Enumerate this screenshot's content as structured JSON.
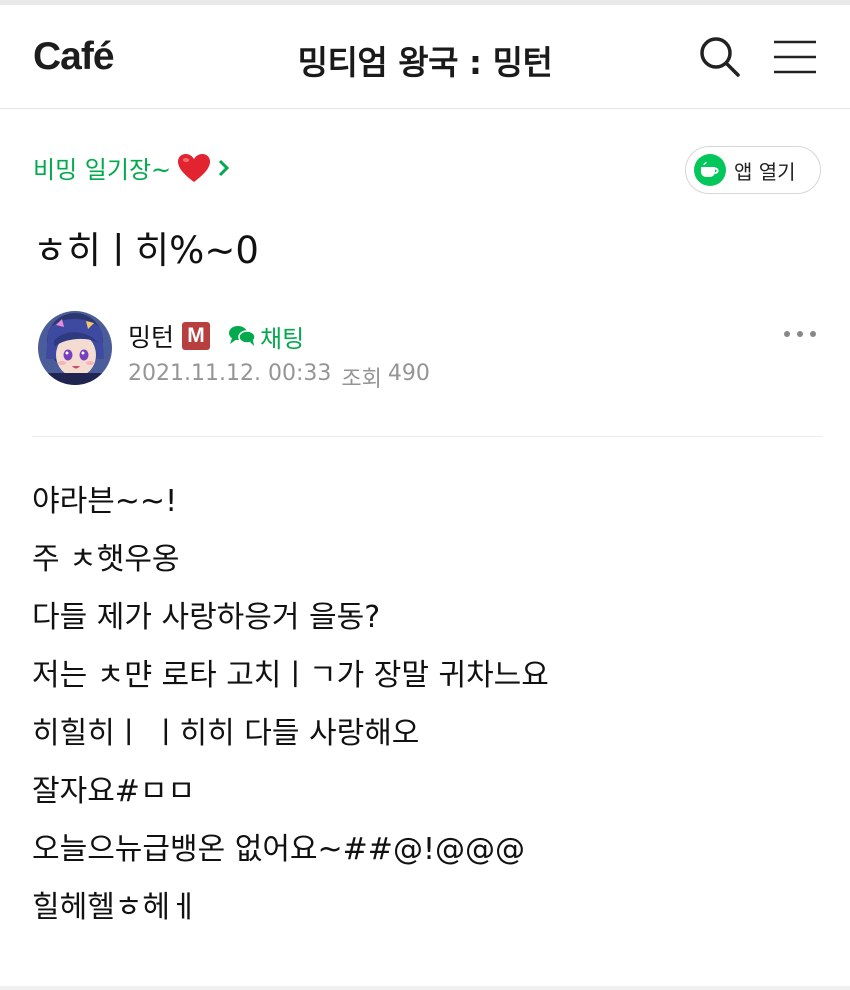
{
  "header": {
    "logo_text": "Café",
    "cafe_name": "밍티엄 왕국 : 밍턴",
    "search_icon": "search-icon",
    "menu_icon": "hamburger-menu-icon"
  },
  "board": {
    "name": "비밍 일기장~",
    "heart_icon": "heart-icon",
    "chevron_icon": "chevron-right-icon"
  },
  "app_open": {
    "label": "앱 열기",
    "icon": "cafe-app-icon"
  },
  "post": {
    "title": "ㅎ히ㅣ히%~0",
    "author": {
      "name": "밍턴",
      "badge": "M",
      "chat_label": "채팅",
      "chat_icon": "chat-bubble-icon",
      "avatar_icon": "avatar"
    },
    "date": "2021.11.12. 00:33",
    "views_label": "조회",
    "views": "490",
    "more_icon": "more-dots-icon",
    "content": [
      "야라븐~~!",
      "주 ㅊ햇우옹",
      "다들 제가 사랑하응거 을동?",
      "저는 ㅊ먄 로타 고치ㅣㄱ가 장말 귀차느요",
      "히힐히ㅣ ㅣ히히 다들 사랑해오",
      "잘자요#ㅁㅁ",
      "오늘으뉴급뱅온 없어요~##@!@@@",
      "힐헤헬ㅎ헤ㅔ"
    ]
  },
  "colors": {
    "brand_green": "#03a94d",
    "badge_red": "#b83f3f",
    "meta_gray": "#959595"
  }
}
